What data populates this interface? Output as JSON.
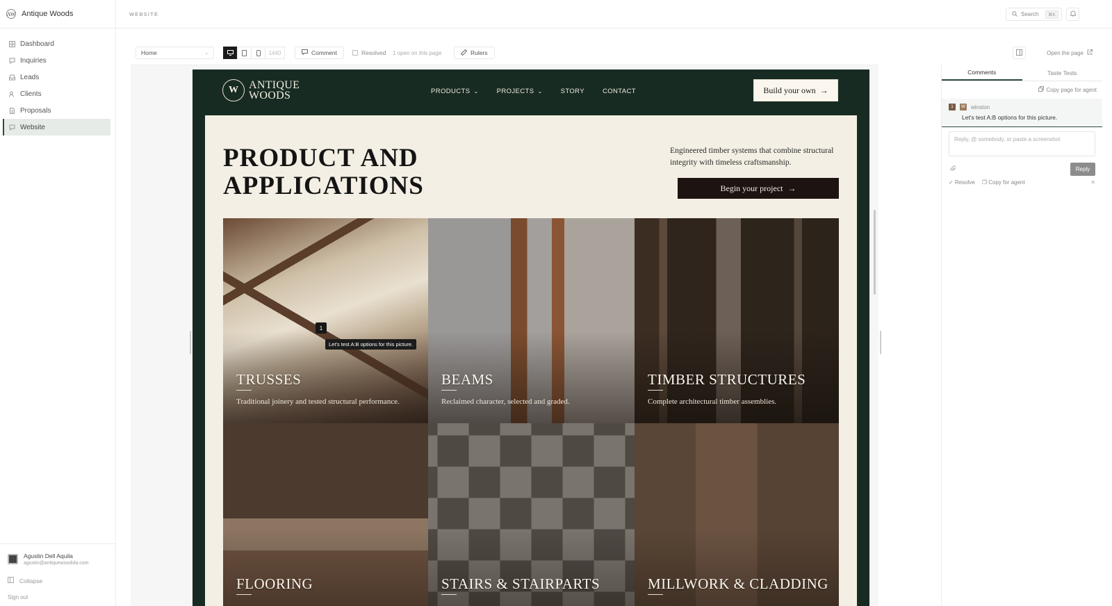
{
  "app": {
    "name": "Antique Woods",
    "logo": "AW"
  },
  "sidebar": {
    "items": [
      {
        "label": "Dashboard",
        "icon": "grid-icon"
      },
      {
        "label": "Inquiries",
        "icon": "chat-icon"
      },
      {
        "label": "Leads",
        "icon": "inbox-icon"
      },
      {
        "label": "Clients",
        "icon": "users-icon"
      },
      {
        "label": "Proposals",
        "icon": "document-icon"
      },
      {
        "label": "Website",
        "icon": "globe-icon",
        "active": true
      }
    ],
    "user": {
      "name": "Agustin Dell Aquila",
      "email": "agustin@antiquewoodsla.com"
    },
    "collapse": "Collapse",
    "sign_out": "Sign out"
  },
  "topbar": {
    "page_label": "WEBSITE",
    "search": "Search",
    "shortcut": "⌘K"
  },
  "toolbar": {
    "page_select": "Home",
    "width": "1440",
    "comment": "Comment",
    "resolved": "Resolved",
    "open_note": "1 open on this page",
    "rulers": "Rulers",
    "open_page": "Open the page"
  },
  "site": {
    "logo_mark": "W",
    "logo_line1": "ANTIQUE",
    "logo_line2": "WOODS",
    "nav": [
      "PRODUCTS",
      "PROJECTS",
      "STORY",
      "CONTACT"
    ],
    "build_button": "Build your own",
    "hero_line1": "PRODUCT AND",
    "hero_line2": "APPLICATIONS",
    "hero_sub": "Engineered timber systems that combine structural integrity with timeless craftsmanship.",
    "begin_button": "Begin your project",
    "tiles": [
      {
        "title": "TRUSSES",
        "desc": "Traditional joinery and tested structural performance."
      },
      {
        "title": "BEAMS",
        "desc": "Reclaimed character, selected and graded."
      },
      {
        "title": "TIMBER STRUCTURES",
        "desc": "Complete architectural timber assemblies."
      },
      {
        "title": "FLOORING",
        "desc": ""
      },
      {
        "title": "STAIRS & STAIRPARTS",
        "desc": ""
      },
      {
        "title": "MILLWORK & CLADDING",
        "desc": ""
      }
    ],
    "marker": "1",
    "tooltip": "Let's test A:B options for this picture."
  },
  "panel": {
    "tabs": [
      "Comments",
      "Taste Tests"
    ],
    "copy_page": "Copy page for agent",
    "thread": {
      "number": "1",
      "initial": "W",
      "author": "winston",
      "text": "Let's test A:B options for this picture."
    },
    "reply_placeholder": "Reply, @ somebody, or paste a screenshot",
    "reply_button": "Reply",
    "resolve": "Resolve",
    "copy_for_agent": "Copy for agent"
  },
  "colors": {
    "site_bg": "#172b22",
    "cream": "#f4efe4",
    "accent": "#2f4a3d"
  }
}
